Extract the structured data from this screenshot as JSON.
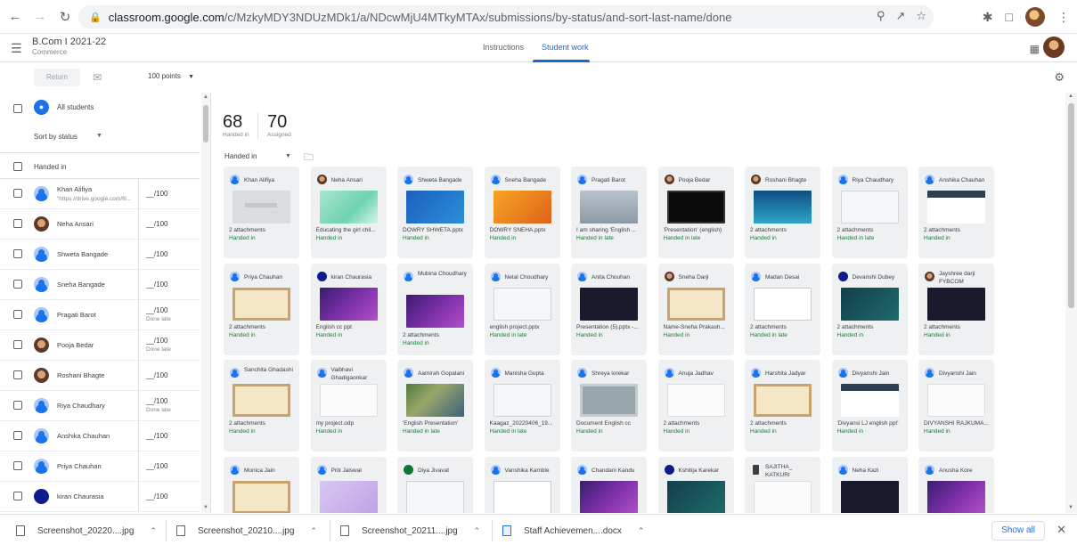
{
  "browser": {
    "url_host": "classroom.google.com",
    "url_path": "/c/MzkyMDY3NDUzMDk1/a/NDcwMjU4MTkyMTAx/submissions/by-status/and-sort-last-name/done"
  },
  "header": {
    "class_name": "B.Com I 2021-22",
    "class_subtitle": "Commerce",
    "tabs": [
      {
        "label": "Instructions"
      },
      {
        "label": "Student work"
      }
    ]
  },
  "toolbar": {
    "return_label": "Return",
    "points": "100 points"
  },
  "left": {
    "all_students": "All students",
    "sort": "Sort by status",
    "section": "Handed in",
    "students": [
      {
        "name": "Khan Alifiya",
        "link": "\"https://drive.google.com/fil...",
        "grade": "__/100",
        "done_late": "",
        "avatar": "default"
      },
      {
        "name": "Neha Ansari",
        "link": "",
        "grade": "__/100",
        "done_late": "",
        "avatar": "photo"
      },
      {
        "name": "Shweta Bangade",
        "link": "",
        "grade": "__/100",
        "done_late": "",
        "avatar": "default"
      },
      {
        "name": "Sneha Bangade",
        "link": "",
        "grade": "__/100",
        "done_late": "",
        "avatar": "default"
      },
      {
        "name": "Pragati Barot",
        "link": "",
        "grade": "__/100",
        "done_late": "Done late",
        "avatar": "default"
      },
      {
        "name": "Pooja Bedar",
        "link": "",
        "grade": "__/100",
        "done_late": "Done late",
        "avatar": "photo"
      },
      {
        "name": "Roshani Bhagte",
        "link": "",
        "grade": "__/100",
        "done_late": "",
        "avatar": "photo"
      },
      {
        "name": "Riya Chaudhary",
        "link": "",
        "grade": "__/100",
        "done_late": "Done late",
        "avatar": "default"
      },
      {
        "name": "Anshika Chauhan",
        "link": "",
        "grade": "__/100",
        "done_late": "",
        "avatar": "default"
      },
      {
        "name": "Priya Chauhan",
        "link": "",
        "grade": "__/100",
        "done_late": "",
        "avatar": "default"
      },
      {
        "name": "kiran Chaurasia",
        "link": "",
        "grade": "__/100",
        "done_late": "",
        "avatar": "dark"
      }
    ]
  },
  "main": {
    "handed_in_count": "68",
    "handed_in_label": "Handed in",
    "assigned_count": "70",
    "assigned_label": "Assigned",
    "filter": "Handed in",
    "cards": [
      {
        "name": "Khan Alifiya",
        "att": "2 attachments",
        "status": "Handed in",
        "thumb": "t-gray",
        "av": "default"
      },
      {
        "name": "Neha Ansari",
        "att": "Educating the girl chil...",
        "status": "Handed in",
        "thumb": "t-mint",
        "av": "photo"
      },
      {
        "name": "Shweta Bangade",
        "att": "DOWRY SHWETA.pptx",
        "status": "Handed in",
        "thumb": "t-blue",
        "av": "default"
      },
      {
        "name": "Sneha Bangade",
        "att": "DOWRY SNEHA.pptx",
        "status": "Handed in",
        "thumb": "t-orange",
        "av": "default"
      },
      {
        "name": "Pragati Barot",
        "att": "I am sharing 'English ...",
        "status": "Handed in late",
        "thumb": "t-slate",
        "av": "default"
      },
      {
        "name": "Pooja Bedar",
        "att": "'Presentation' (english)",
        "status": "Handed in late",
        "thumb": "t-black",
        "av": "photo"
      },
      {
        "name": "Roshani Bhagte",
        "att": "2 attachments",
        "status": "Handed in",
        "thumb": "t-teal",
        "av": "photo"
      },
      {
        "name": "Riya Chaudhary",
        "att": "2 attachments",
        "status": "Handed in late",
        "thumb": "t-light",
        "av": "default"
      },
      {
        "name": "Anshika Chauhan",
        "att": "2 attachments",
        "status": "Handed in",
        "thumb": "t-white",
        "av": "default"
      },
      {
        "name": "Priya Chauhan",
        "att": "2 attachments",
        "status": "Handed in",
        "thumb": "t-beige",
        "av": "default"
      },
      {
        "name": "kiran Chaurasia",
        "att": "English cc ppt",
        "status": "Handed in",
        "thumb": "t-purple",
        "av": "dark"
      },
      {
        "name": "Mubina Choudhary",
        "att": "2 attachments",
        "status": "Handed in",
        "thumb": "t-purple",
        "av": "default",
        "two": true
      },
      {
        "name": "Netal Choudhary",
        "att": "english project.pptx",
        "status": "Handed in late",
        "thumb": "t-light",
        "av": "default"
      },
      {
        "name": "Anita Chouhan",
        "att": "Presentation (5).pptx -...",
        "status": "Handed in",
        "thumb": "t-ink",
        "av": "default"
      },
      {
        "name": "Sneha Darji",
        "att": "Name-Sneha Prakash...",
        "status": "Handed in",
        "thumb": "t-beige",
        "av": "photo"
      },
      {
        "name": "Madan Desai",
        "att": "2 attachments",
        "status": "Handed in late",
        "thumb": "t-boxwhite",
        "av": "default"
      },
      {
        "name": "Devanshi Dubey",
        "att": "2 attachments",
        "status": "Handed in",
        "thumb": "t-darkteal",
        "av": "dark"
      },
      {
        "name": "Jayshree darji FYBCOM",
        "att": "2 attachments",
        "status": "Handed in",
        "thumb": "t-ink",
        "av": "photo",
        "two": true
      },
      {
        "name": "Sanchita Ghadashi",
        "att": "2 attachments",
        "status": "Handed in",
        "thumb": "t-beige",
        "av": "default",
        "two": true
      },
      {
        "name": "Vaibhavi Ghadigaonkar",
        "att": "my project.odp",
        "status": "Handed in",
        "thumb": "t-paper",
        "av": "default",
        "two": true
      },
      {
        "name": "Aamirah Gopalani",
        "att": "'English Presentation'",
        "status": "Handed in late",
        "thumb": "t-map",
        "av": "default"
      },
      {
        "name": "Manisha Gupta",
        "att": "Kaagaz_20220406_19...",
        "status": "Handed in late",
        "thumb": "t-light",
        "av": "default"
      },
      {
        "name": "Shreya lorekar",
        "att": "Document English cc",
        "status": "Handed in",
        "thumb": "t-gslide",
        "av": "default"
      },
      {
        "name": "Anuja Jadhav",
        "att": "2 attachments",
        "status": "Handed in",
        "thumb": "t-paper",
        "av": "default"
      },
      {
        "name": "Harshita Jadyar",
        "att": "2 attachments",
        "status": "Handed in",
        "thumb": "t-beige",
        "av": "default"
      },
      {
        "name": "Divyanshi Jain",
        "att": "'Divyansi LJ english ppt'",
        "status": "Handed in",
        "thumb": "t-white",
        "av": "default"
      },
      {
        "name": "Divyanshi Jain",
        "att": "DIVYANSHI RAJKUMA...",
        "status": "Handed in",
        "thumb": "t-paper",
        "av": "default"
      },
      {
        "name": "Monica Jain",
        "att": "",
        "status": "",
        "thumb": "t-beige",
        "av": "default"
      },
      {
        "name": "Priti Jaiswal",
        "att": "",
        "status": "",
        "thumb": "t-lav",
        "av": "default"
      },
      {
        "name": "Diya Jivavat",
        "att": "",
        "status": "",
        "thumb": "t-light",
        "av": "green"
      },
      {
        "name": "Vanshika Kamble",
        "att": "",
        "status": "",
        "thumb": "t-boxwhite",
        "av": "default"
      },
      {
        "name": "Chandani Kandu",
        "att": "",
        "status": "",
        "thumb": "t-purple",
        "av": "default"
      },
      {
        "name": "Kshitija Karekar",
        "att": "",
        "status": "",
        "thumb": "t-darkteal",
        "av": "dark"
      },
      {
        "name": "SAJITHA_ KATKURI",
        "att": "",
        "status": "",
        "thumb": "t-paper",
        "av": "doc",
        "two": true
      },
      {
        "name": "Neha Kazi",
        "att": "",
        "status": "",
        "thumb": "t-ink",
        "av": "default"
      },
      {
        "name": "Anusha Kore",
        "att": "",
        "status": "",
        "thumb": "t-purple",
        "av": "default"
      }
    ]
  },
  "downloads": {
    "items": [
      {
        "name": "Screenshot_20220....jpg",
        "type": "jpg"
      },
      {
        "name": "Screenshot_20210....jpg",
        "type": "jpg"
      },
      {
        "name": "Screenshot_20211....jpg",
        "type": "jpg"
      },
      {
        "name": "Staff Achievemen....docx",
        "type": "docx"
      }
    ],
    "show_all": "Show all"
  }
}
